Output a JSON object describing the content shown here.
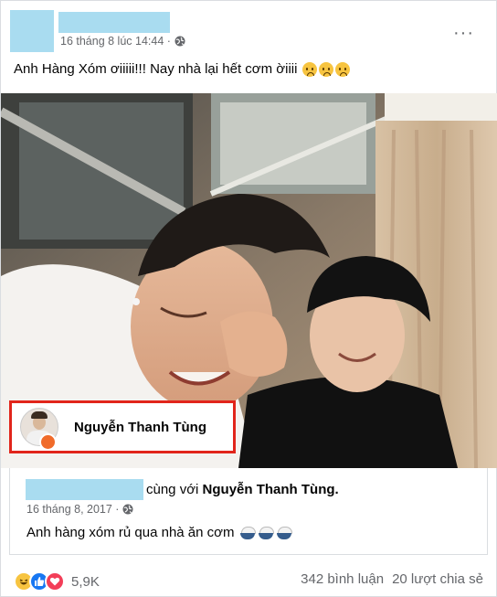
{
  "post": {
    "timestamp": "16 tháng 8 lúc 14:44 ·",
    "privacy_icon": "globe-icon",
    "more_label": "···",
    "caption": "Anh Hàng Xóm ơiiiii!!! Nay nhà lại hết cơm ờiiii",
    "caption_emoji_count": 3,
    "caption_emoji": "sad-face-emoji"
  },
  "tag": {
    "name": "Nguyễn Thanh Tùng",
    "highlight_color": "#e1251b"
  },
  "shared": {
    "with_prefix": "cùng với",
    "with_name": "Nguyễn Thanh Tùng.",
    "timestamp": "16 tháng 8, 2017 ·",
    "privacy_icon": "globe-icon",
    "text": "Anh hàng xóm rủ qua nhà ăn cơm",
    "emoji": "rice-bowl-emoji",
    "emoji_count": 3
  },
  "footer": {
    "reactions": [
      "haha",
      "like",
      "love"
    ],
    "reaction_count": "5,9K",
    "comments": "342 bình luận",
    "shares": "20 lượt chia sẻ"
  },
  "colors": {
    "redaction": "#a9dcf0",
    "secondary_text": "#65676b",
    "like_blue": "#1877f2",
    "love_red": "#f33e58",
    "haha_yellow": "#f7c440"
  }
}
